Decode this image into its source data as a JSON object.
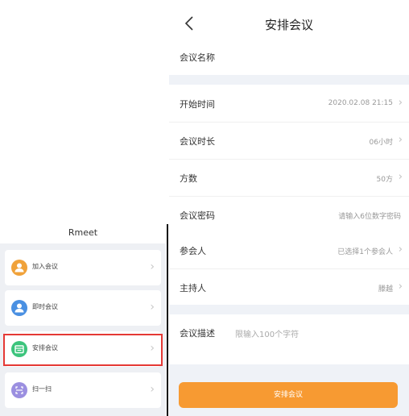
{
  "left": {
    "title": "Rmeet",
    "menu": [
      {
        "label": "加入会议",
        "icon": "person-add-icon",
        "color": "#f0a23a"
      },
      {
        "label": "即时会议",
        "icon": "person-icon",
        "color": "#4a90e2"
      },
      {
        "label": "安排会议",
        "icon": "calendar-icon",
        "color": "#3cc47c"
      },
      {
        "label": "扫一扫",
        "icon": "scan-icon",
        "color": "#9b8fe0"
      }
    ],
    "highlighted_item": "安排会议",
    "highlight_color": "#e53935"
  },
  "right": {
    "title": "安排会议",
    "topic_label": "会议名称",
    "start_label": "开始时间",
    "start_value": "2020.02.08 21:15",
    "duration_label": "会议时长",
    "duration_value": "06小时",
    "parties_label": "方数",
    "parties_value": "50方",
    "password_label": "会议密码",
    "password_placeholder": "请输入6位数字密码",
    "attendees_label": "参会人",
    "attendees_value": "已选择1个参会人",
    "host_label": "主持人",
    "host_value": "滕越",
    "desc_label": "会议描述",
    "desc_placeholder": "限输入100个字符",
    "submit_label": "安排会议",
    "accent_color": "#f79a32"
  }
}
